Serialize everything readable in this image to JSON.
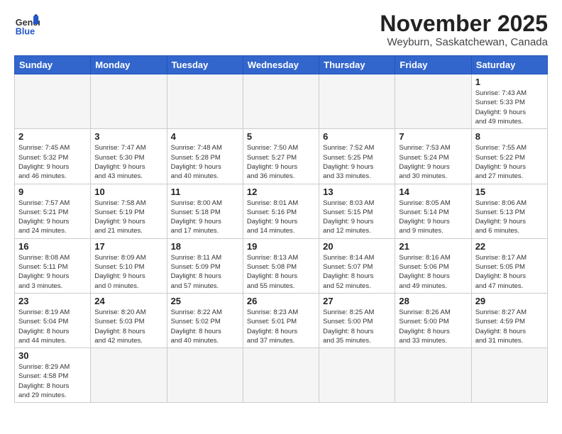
{
  "header": {
    "logo_general": "General",
    "logo_blue": "Blue",
    "month_title": "November 2025",
    "location": "Weyburn, Saskatchewan, Canada"
  },
  "weekdays": [
    "Sunday",
    "Monday",
    "Tuesday",
    "Wednesday",
    "Thursday",
    "Friday",
    "Saturday"
  ],
  "weeks": [
    [
      {
        "day": "",
        "info": ""
      },
      {
        "day": "",
        "info": ""
      },
      {
        "day": "",
        "info": ""
      },
      {
        "day": "",
        "info": ""
      },
      {
        "day": "",
        "info": ""
      },
      {
        "day": "",
        "info": ""
      },
      {
        "day": "1",
        "info": "Sunrise: 7:43 AM\nSunset: 5:33 PM\nDaylight: 9 hours\nand 49 minutes."
      }
    ],
    [
      {
        "day": "2",
        "info": "Sunrise: 7:45 AM\nSunset: 5:32 PM\nDaylight: 9 hours\nand 46 minutes."
      },
      {
        "day": "3",
        "info": "Sunrise: 7:47 AM\nSunset: 5:30 PM\nDaylight: 9 hours\nand 43 minutes."
      },
      {
        "day": "4",
        "info": "Sunrise: 7:48 AM\nSunset: 5:28 PM\nDaylight: 9 hours\nand 40 minutes."
      },
      {
        "day": "5",
        "info": "Sunrise: 7:50 AM\nSunset: 5:27 PM\nDaylight: 9 hours\nand 36 minutes."
      },
      {
        "day": "6",
        "info": "Sunrise: 7:52 AM\nSunset: 5:25 PM\nDaylight: 9 hours\nand 33 minutes."
      },
      {
        "day": "7",
        "info": "Sunrise: 7:53 AM\nSunset: 5:24 PM\nDaylight: 9 hours\nand 30 minutes."
      },
      {
        "day": "8",
        "info": "Sunrise: 7:55 AM\nSunset: 5:22 PM\nDaylight: 9 hours\nand 27 minutes."
      }
    ],
    [
      {
        "day": "9",
        "info": "Sunrise: 7:57 AM\nSunset: 5:21 PM\nDaylight: 9 hours\nand 24 minutes."
      },
      {
        "day": "10",
        "info": "Sunrise: 7:58 AM\nSunset: 5:19 PM\nDaylight: 9 hours\nand 21 minutes."
      },
      {
        "day": "11",
        "info": "Sunrise: 8:00 AM\nSunset: 5:18 PM\nDaylight: 9 hours\nand 17 minutes."
      },
      {
        "day": "12",
        "info": "Sunrise: 8:01 AM\nSunset: 5:16 PM\nDaylight: 9 hours\nand 14 minutes."
      },
      {
        "day": "13",
        "info": "Sunrise: 8:03 AM\nSunset: 5:15 PM\nDaylight: 9 hours\nand 12 minutes."
      },
      {
        "day": "14",
        "info": "Sunrise: 8:05 AM\nSunset: 5:14 PM\nDaylight: 9 hours\nand 9 minutes."
      },
      {
        "day": "15",
        "info": "Sunrise: 8:06 AM\nSunset: 5:13 PM\nDaylight: 9 hours\nand 6 minutes."
      }
    ],
    [
      {
        "day": "16",
        "info": "Sunrise: 8:08 AM\nSunset: 5:11 PM\nDaylight: 9 hours\nand 3 minutes."
      },
      {
        "day": "17",
        "info": "Sunrise: 8:09 AM\nSunset: 5:10 PM\nDaylight: 9 hours\nand 0 minutes."
      },
      {
        "day": "18",
        "info": "Sunrise: 8:11 AM\nSunset: 5:09 PM\nDaylight: 8 hours\nand 57 minutes."
      },
      {
        "day": "19",
        "info": "Sunrise: 8:13 AM\nSunset: 5:08 PM\nDaylight: 8 hours\nand 55 minutes."
      },
      {
        "day": "20",
        "info": "Sunrise: 8:14 AM\nSunset: 5:07 PM\nDaylight: 8 hours\nand 52 minutes."
      },
      {
        "day": "21",
        "info": "Sunrise: 8:16 AM\nSunset: 5:06 PM\nDaylight: 8 hours\nand 49 minutes."
      },
      {
        "day": "22",
        "info": "Sunrise: 8:17 AM\nSunset: 5:05 PM\nDaylight: 8 hours\nand 47 minutes."
      }
    ],
    [
      {
        "day": "23",
        "info": "Sunrise: 8:19 AM\nSunset: 5:04 PM\nDaylight: 8 hours\nand 44 minutes."
      },
      {
        "day": "24",
        "info": "Sunrise: 8:20 AM\nSunset: 5:03 PM\nDaylight: 8 hours\nand 42 minutes."
      },
      {
        "day": "25",
        "info": "Sunrise: 8:22 AM\nSunset: 5:02 PM\nDaylight: 8 hours\nand 40 minutes."
      },
      {
        "day": "26",
        "info": "Sunrise: 8:23 AM\nSunset: 5:01 PM\nDaylight: 8 hours\nand 37 minutes."
      },
      {
        "day": "27",
        "info": "Sunrise: 8:25 AM\nSunset: 5:00 PM\nDaylight: 8 hours\nand 35 minutes."
      },
      {
        "day": "28",
        "info": "Sunrise: 8:26 AM\nSunset: 5:00 PM\nDaylight: 8 hours\nand 33 minutes."
      },
      {
        "day": "29",
        "info": "Sunrise: 8:27 AM\nSunset: 4:59 PM\nDaylight: 8 hours\nand 31 minutes."
      }
    ],
    [
      {
        "day": "30",
        "info": "Sunrise: 8:29 AM\nSunset: 4:58 PM\nDaylight: 8 hours\nand 29 minutes."
      },
      {
        "day": "",
        "info": ""
      },
      {
        "day": "",
        "info": ""
      },
      {
        "day": "",
        "info": ""
      },
      {
        "day": "",
        "info": ""
      },
      {
        "day": "",
        "info": ""
      },
      {
        "day": "",
        "info": ""
      }
    ]
  ]
}
